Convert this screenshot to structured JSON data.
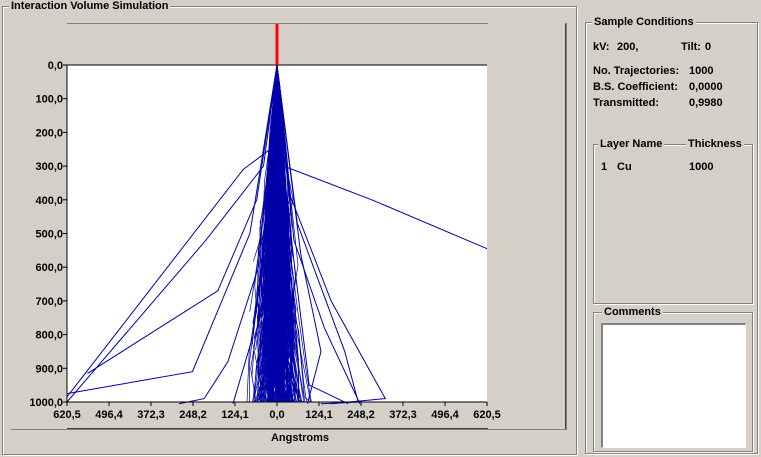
{
  "simulation": {
    "title": "Interaction Volume Simulation",
    "x_axis_title": "Angstroms"
  },
  "chart_data": {
    "type": "line",
    "xlabel": "Angstroms",
    "ylabel": "",
    "xlim": [
      -620.5,
      620.5
    ],
    "ylim": [
      1000,
      0
    ],
    "x_tick_labels": [
      "620,5",
      "496,4",
      "372,3",
      "248,2",
      "124,1",
      "0,0",
      "124,1",
      "248,2",
      "372,3",
      "496,4",
      "620,5"
    ],
    "x_ticks": [
      -620.5,
      -496.4,
      -372.3,
      -248.2,
      -124.1,
      0,
      124.1,
      248.2,
      372.3,
      496.4,
      620.5
    ],
    "y_tick_labels": [
      "0,0",
      "100,0",
      "200,0",
      "300,0",
      "400,0",
      "500,0",
      "600,0",
      "700,0",
      "800,0",
      "900,0",
      "1000,0"
    ],
    "y_ticks": [
      0,
      100,
      200,
      300,
      400,
      500,
      600,
      700,
      800,
      900,
      1000
    ],
    "beam_color": "#ff0000",
    "trajectory_color": "#0000aa",
    "series": [
      {
        "x": [
          0,
          20,
          280,
          620.5
        ],
        "y": [
          0,
          300,
          400,
          545
        ]
      },
      {
        "x": [
          0,
          -20,
          -100,
          -620.5
        ],
        "y": [
          0,
          250,
          310,
          985
        ]
      },
      {
        "x": [
          0,
          -40,
          -210,
          -620.5
        ],
        "y": [
          0,
          300,
          520,
          1000
        ]
      },
      {
        "x": [
          0,
          -60,
          -175,
          -560
        ],
        "y": [
          0,
          400,
          670,
          915
        ]
      },
      {
        "x": [
          0,
          -80,
          -250,
          -620.5
        ],
        "y": [
          0,
          500,
          910,
          975
        ]
      },
      {
        "x": [
          0,
          40,
          160,
          320,
          160
        ],
        "y": [
          0,
          390,
          700,
          990,
          1005
        ]
      },
      {
        "x": [
          0,
          60,
          200,
          240,
          130
        ],
        "y": [
          0,
          470,
          850,
          1000,
          1005
        ]
      },
      {
        "x": [
          0,
          50,
          140,
          245
        ],
        "y": [
          0,
          520,
          780,
          1005
        ]
      },
      {
        "x": [
          0,
          -55,
          -145,
          -215,
          -290
        ],
        "y": [
          0,
          600,
          880,
          990,
          1005
        ]
      },
      {
        "x": [
          0,
          70,
          130,
          90
        ],
        "y": [
          0,
          560,
          850,
          1005
        ]
      },
      {
        "x": [
          0,
          30,
          95,
          210
        ],
        "y": [
          0,
          420,
          950,
          1005
        ]
      },
      {
        "x": [
          0,
          -35,
          -70,
          -130
        ],
        "y": [
          0,
          480,
          800,
          1005
        ]
      }
    ]
  },
  "sample_conditions": {
    "title": "Sample Conditions",
    "kv_label": "kV:",
    "kv_value": "200,",
    "tilt_label": "Tilt:",
    "tilt_value": "0",
    "trajectories_label": "No. Trajectories:",
    "trajectories_value": "1000",
    "bs_label": "B.S. Coefficient:",
    "bs_value": "0,0000",
    "transmitted_label": "Transmitted:",
    "transmitted_value": "0,9980"
  },
  "layers": {
    "name_header": "Layer Name",
    "thickness_header": "Thickness",
    "rows": [
      {
        "index": "1",
        "name": "Cu",
        "thickness": "1000"
      }
    ]
  },
  "comments": {
    "title": "Comments",
    "text": ""
  }
}
